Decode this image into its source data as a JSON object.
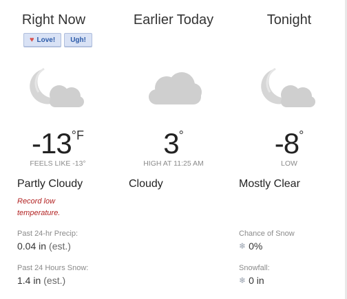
{
  "columns": [
    {
      "header": "Right Now",
      "badges": [
        {
          "icon": "heart-icon",
          "label": "Love!"
        },
        {
          "label": "Ugh!"
        }
      ],
      "icon": "moon-cloud-icon",
      "temp": "-13",
      "unit": "°F",
      "sub": "FEELS LIKE -13°",
      "condition": "Partly Cloudy",
      "note": "Record low temperature.",
      "stats": [
        {
          "label": "Past 24-hr Precip:",
          "value": "0.04 in",
          "suffix": "(est.)"
        },
        {
          "label": "Past 24 Hours Snow:",
          "value": "1.4 in",
          "suffix": "(est.)"
        }
      ]
    },
    {
      "header": "Earlier Today",
      "icon": "cloud-icon",
      "temp": "3",
      "unit": "°",
      "sub": "HIGH AT 11:25 AM",
      "condition": "Cloudy"
    },
    {
      "header": "Tonight",
      "icon": "moon-cloud-icon",
      "temp": "-8",
      "unit": "°",
      "sub": "LOW",
      "condition": "Mostly Clear",
      "stats": [
        {
          "label": "Chance of Snow",
          "value": "0%",
          "icon": "snowflake-icon",
          "glyph": "❄"
        },
        {
          "label": "Snowfall:",
          "value": "0 in",
          "icon": "snowflake-icon",
          "glyph": "❄"
        }
      ]
    }
  ],
  "colors": {
    "icon_gray": "#cfcfcf",
    "record_red": "#b22222",
    "badge_bg": "#d9e2f5",
    "badge_text": "#2b5aa8"
  }
}
